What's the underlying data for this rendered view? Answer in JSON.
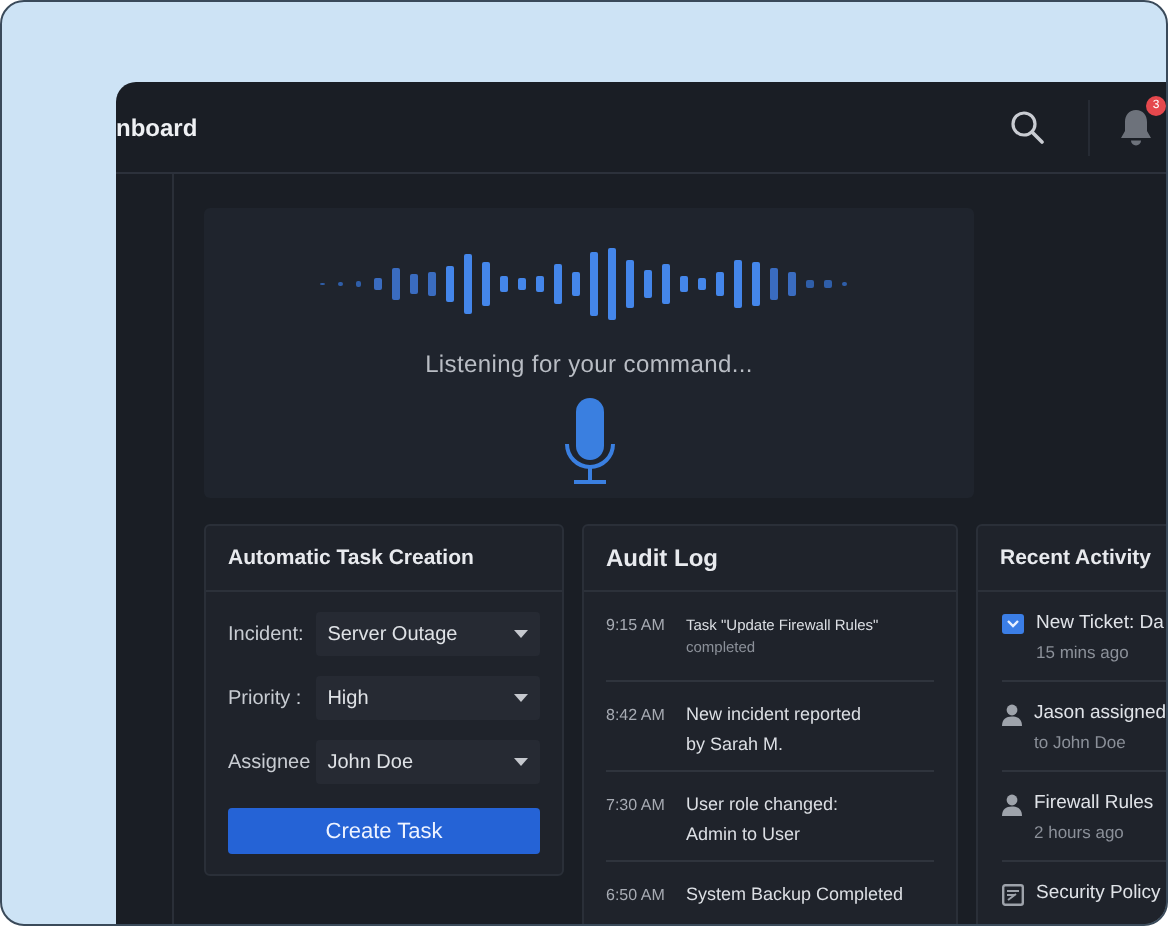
{
  "window": {
    "title": "nboard",
    "notifications": "3"
  },
  "voice": {
    "status": "Listening for your command..."
  },
  "task_form": {
    "title": "Automatic Task Creation",
    "fields": [
      {
        "label": "Incident:",
        "value": "Server Outage"
      },
      {
        "label": "Priority :",
        "value": "High"
      },
      {
        "label": "Assignee",
        "value": "John Doe"
      }
    ],
    "button": "Create Task"
  },
  "audit_log": {
    "title": "Audit Log",
    "entries": [
      {
        "time": "9:15 AM",
        "text": "Task \"Update Firewall Rules\"",
        "detail": "completed"
      },
      {
        "time": "8:42 AM",
        "text": "New incident reported\nby Sarah M."
      },
      {
        "time": "7:30 AM",
        "text": "User role changed:\nAdmin to User"
      },
      {
        "time": "6:50 AM",
        "text": "System Backup Completed"
      }
    ]
  },
  "recent_activity": {
    "title": "Recent Activity",
    "items": [
      {
        "kind": "ticket",
        "title": "New Ticket: Da",
        "time": "15 mins ago"
      },
      {
        "kind": "person",
        "title": "Jason assigned",
        "time": "to John Doe"
      },
      {
        "kind": "person",
        "title": "Firewall Rules",
        "time": "2 hours ago"
      },
      {
        "kind": "document",
        "title": "Security Policy"
      }
    ]
  }
}
